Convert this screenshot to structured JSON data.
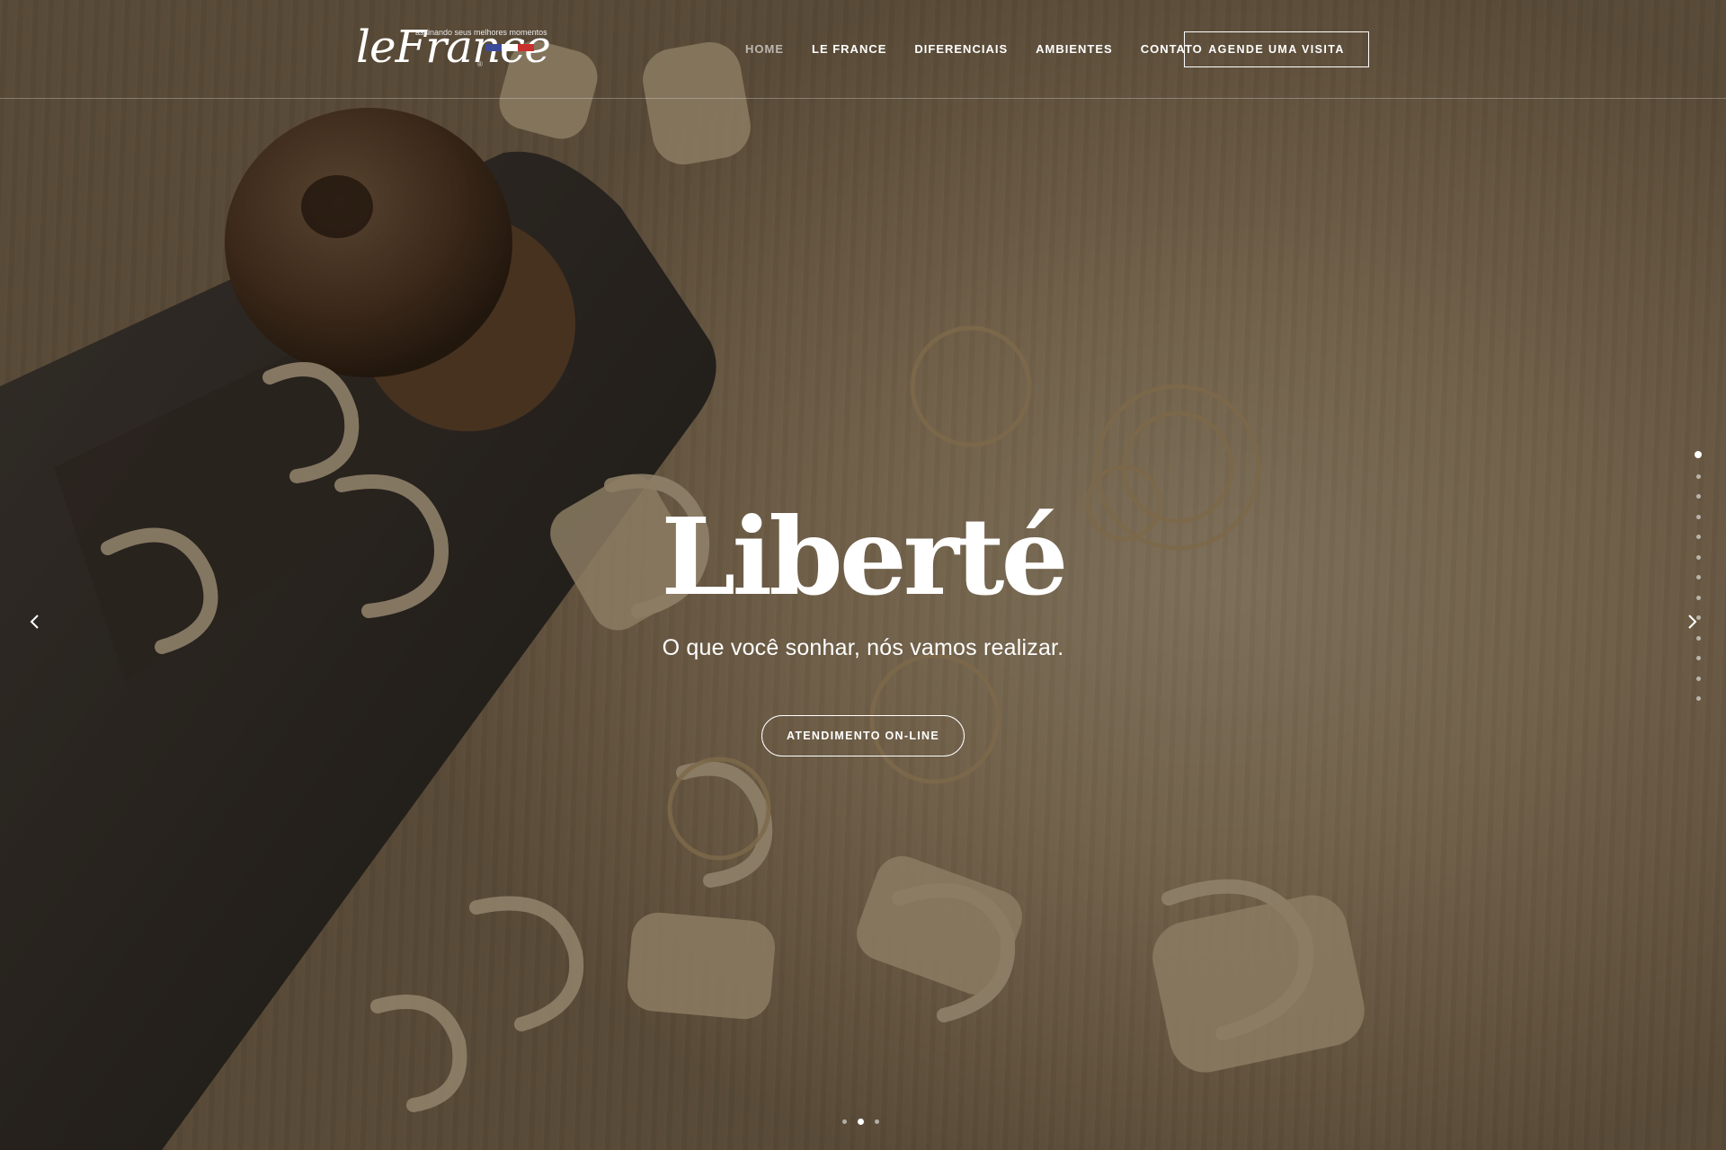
{
  "logo": {
    "wordmark": "leFrance",
    "tagline": "assinando seus melhores momentos",
    "registered": "®",
    "flag_colors": [
      "#3b4b9a",
      "#ffffff",
      "#c8302e"
    ]
  },
  "nav": {
    "items": [
      {
        "label": "HOME",
        "active": true
      },
      {
        "label": "LE FRANCE",
        "active": false
      },
      {
        "label": "DIFERENCIAIS",
        "active": false
      },
      {
        "label": "AMBIENTES",
        "active": false
      },
      {
        "label": "CONTATO",
        "active": false
      }
    ],
    "cta_label": "AGENDE UMA VISITA"
  },
  "hero": {
    "title": "Liberté",
    "subtitle": "O que você sonhar, nós vamos realizar.",
    "button_label": "ATENDIMENTO ON-LINE"
  },
  "slider": {
    "vertical_dot_count": 13,
    "vertical_active_index": 0,
    "horizontal_dot_count": 3,
    "horizontal_active_index": 1,
    "prev_icon": "chevron-left-icon",
    "next_icon": "chevron-right-icon"
  },
  "colors": {
    "text": "#ffffff",
    "overlay": "rgba(20,14,8,0.42)",
    "wood_light": "#c9b494",
    "wood_dark": "#8a7459"
  }
}
